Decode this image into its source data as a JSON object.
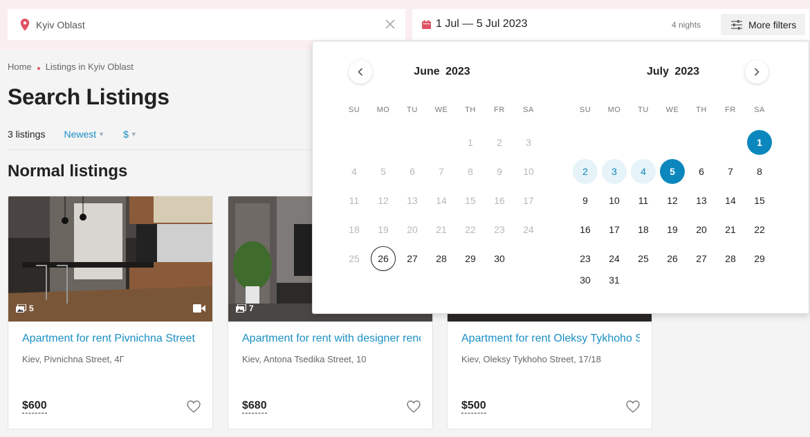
{
  "search": {
    "location_value": "Kyiv Oblast",
    "date_range": "1 Jul — 5 Jul 2023",
    "nights": "4 nights",
    "more_filters_label": "More filters"
  },
  "breadcrumb": {
    "home": "Home",
    "current": "Listings in Kyiv Oblast"
  },
  "page_title": "Search Listings",
  "sort": {
    "count": "3 listings",
    "order": "Newest",
    "currency": "$"
  },
  "section_title": "Normal listings",
  "listings": [
    {
      "title": "Apartment for rent Pivnichna Street",
      "address": "Kiev, Pivnichna Street, 4Г",
      "price": "$600",
      "photos": "5",
      "has_video": true
    },
    {
      "title": "Apartment for rent with designer renovation",
      "address": "Kiev, Antona Tsedika Street, 10",
      "price": "$680",
      "photos": "7",
      "has_video": false
    },
    {
      "title": "Apartment for rent Oleksy Tykhoho Street",
      "address": "Kiev, Oleksy Tykhoho Street, 17/18",
      "price": "$500",
      "photos": "",
      "has_video": false
    }
  ],
  "datepicker": {
    "weekdays": [
      "SU",
      "MO",
      "TU",
      "WE",
      "TH",
      "FR",
      "SA"
    ],
    "months": [
      {
        "title": "June  2023",
        "first_weekday": 4,
        "days": 30,
        "past_until": 25,
        "today": 26,
        "in_range": [],
        "selected": []
      },
      {
        "title": "July  2023",
        "first_weekday": 6,
        "days": 31,
        "past_until": 0,
        "today": 0,
        "in_range": [
          2,
          3,
          4
        ],
        "selected": [
          1,
          5
        ]
      }
    ]
  },
  "colors": {
    "accent": "#0c87bd",
    "link": "#1a8fc4",
    "pin": "#e05263",
    "topbar": "#fbeef0"
  }
}
